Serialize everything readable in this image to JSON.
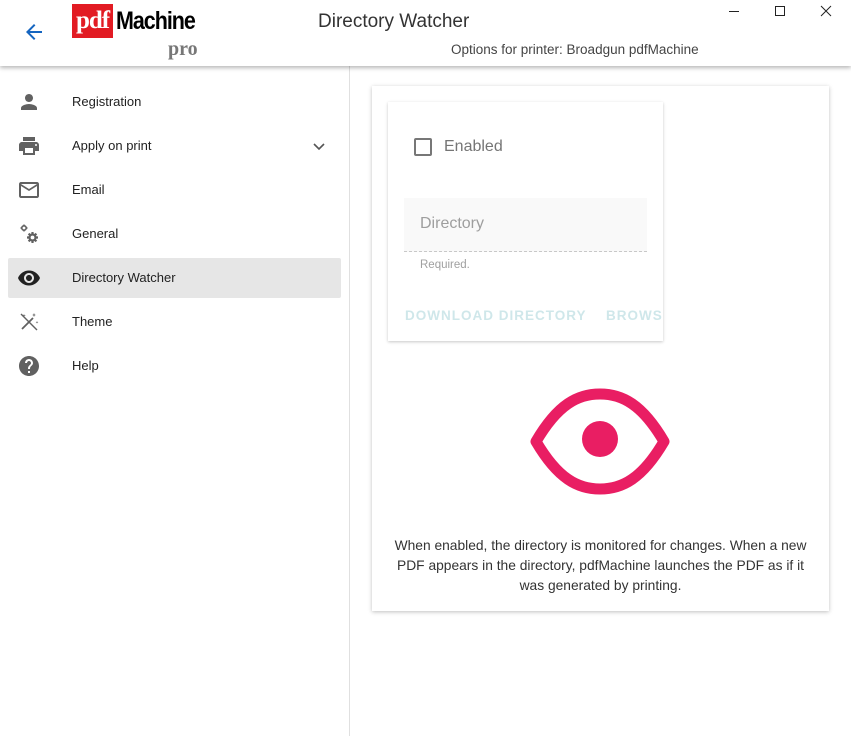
{
  "header": {
    "logo": {
      "pdf": "pdf",
      "machine": "Machine",
      "pro": "pro"
    },
    "title": "Directory Watcher",
    "subtitle": "Options for printer: Broadgun pdfMachine"
  },
  "window_controls": [
    "minimize-icon",
    "maximize-icon",
    "close-icon"
  ],
  "sidebar": {
    "items": [
      {
        "label": "Registration",
        "icon": "person-icon"
      },
      {
        "label": "Apply on print",
        "icon": "printer-icon",
        "expandable": true
      },
      {
        "label": "Email",
        "icon": "mail-icon"
      },
      {
        "label": "General",
        "icon": "gears-icon"
      },
      {
        "label": "Directory Watcher",
        "icon": "eye-icon",
        "active": true
      },
      {
        "label": "Theme",
        "icon": "theme-wand-icon"
      },
      {
        "label": "Help",
        "icon": "help-icon"
      }
    ]
  },
  "form": {
    "enabled_label": "Enabled",
    "enabled_checked": false,
    "directory_placeholder": "Directory",
    "directory_value": "",
    "directory_hint": "Required.",
    "download_button": "DOWNLOAD DIRECTORY",
    "browse_button": "BROWSE"
  },
  "description": "When enabled, the directory is monitored for changes. When a new PDF appears in the directory, pdfMachine launches the PDF as if it was generated by printing.",
  "colors": {
    "accent_eye": "#e91e63",
    "disabled_button_text": "#cfe7ea",
    "logo_red": "#e21b23",
    "back_arrow": "#1565c0",
    "active_nav_bg": "#e6e6e6"
  }
}
